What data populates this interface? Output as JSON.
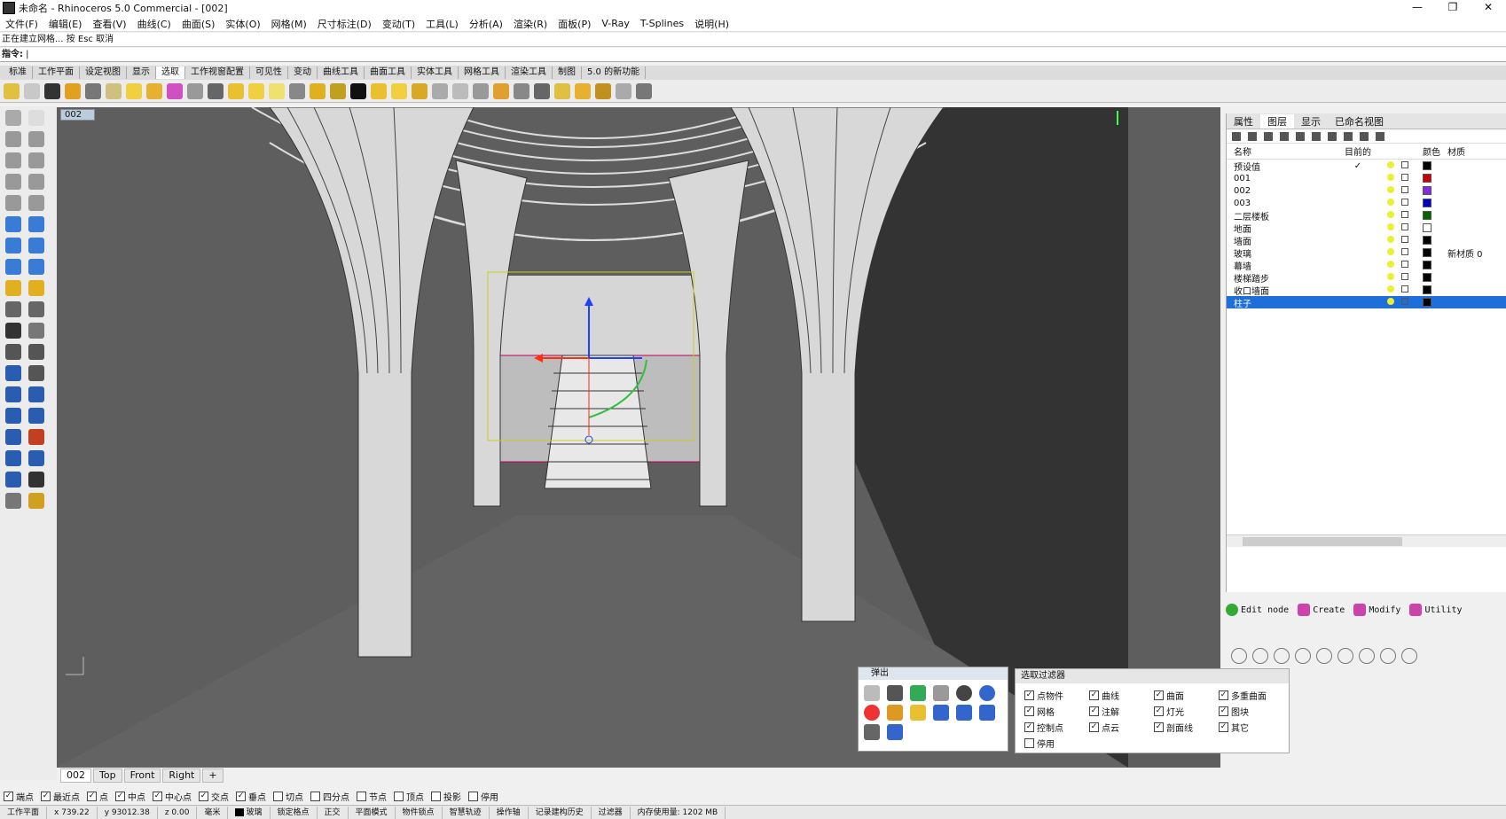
{
  "window": {
    "title": "未命名 - Rhinoceros 5.0 Commercial - [002]",
    "controls": [
      "—",
      "❐",
      "✕"
    ]
  },
  "menu": [
    "文件(F)",
    "编辑(E)",
    "查看(V)",
    "曲线(C)",
    "曲面(S)",
    "实体(O)",
    "网格(M)",
    "尺寸标注(D)",
    "变动(T)",
    "工具(L)",
    "分析(A)",
    "渲染(R)",
    "面板(P)",
    "V-Ray",
    "T-Splines",
    "说明(H)"
  ],
  "command": {
    "history": "正在建立网格... 按 Esc 取消",
    "prompt": "指令:"
  },
  "toolbar_tabs": [
    "标准",
    "工作平面",
    "设定视图",
    "显示",
    "选取",
    "工作视窗配置",
    "可见性",
    "变动",
    "曲线工具",
    "曲面工具",
    "实体工具",
    "网格工具",
    "渲染工具",
    "制图",
    "5.0 的新功能"
  ],
  "toolbar_active_tab": "选取",
  "viewport": {
    "label": "002",
    "tabs": [
      "002",
      "Top",
      "Front",
      "Right",
      "+"
    ]
  },
  "right_panel": {
    "tabs": [
      "属性",
      "图层",
      "显示",
      "已命名视图"
    ],
    "columns": [
      "名称",
      "目前的",
      "颜色",
      "材质"
    ],
    "layers": [
      {
        "name": "预设值",
        "current": "✓",
        "color": "#000000",
        "material": ""
      },
      {
        "name": "001",
        "current": "",
        "color": "#cc0000",
        "material": ""
      },
      {
        "name": "002",
        "current": "",
        "color": "#8a2be2",
        "material": ""
      },
      {
        "name": "003",
        "current": "",
        "color": "#0000cc",
        "material": ""
      },
      {
        "name": "二层楼板",
        "current": "",
        "color": "#006600",
        "material": ""
      },
      {
        "name": "地面",
        "current": "",
        "color": "#ffffff",
        "material": ""
      },
      {
        "name": "墙面",
        "current": "",
        "color": "#000000",
        "material": ""
      },
      {
        "name": "玻璃",
        "current": "",
        "color": "#000000",
        "material": "新材质 0"
      },
      {
        "name": "幕墙",
        "current": "",
        "color": "#000000",
        "material": ""
      },
      {
        "name": "楼梯踏步",
        "current": "",
        "color": "#000000",
        "material": ""
      },
      {
        "name": "收口墙面",
        "current": "",
        "color": "#000000",
        "material": ""
      },
      {
        "name": "柱子",
        "current": "",
        "color": "#000000",
        "material": ""
      }
    ],
    "selected_layer": "柱子"
  },
  "vray": {
    "buttons": [
      "Edit node",
      "Create",
      "Modify",
      "Utility"
    ]
  },
  "popup": {
    "title": "弹出"
  },
  "selection_filter": {
    "title": "选取过滤器",
    "items": [
      {
        "label": "点物件",
        "checked": true
      },
      {
        "label": "曲线",
        "checked": true
      },
      {
        "label": "曲面",
        "checked": true
      },
      {
        "label": "多重曲面",
        "checked": true
      },
      {
        "label": "网格",
        "checked": true
      },
      {
        "label": "注解",
        "checked": true
      },
      {
        "label": "灯光",
        "checked": true
      },
      {
        "label": "图块",
        "checked": true
      },
      {
        "label": "控制点",
        "checked": true
      },
      {
        "label": "点云",
        "checked": true
      },
      {
        "label": "剖面线",
        "checked": true
      },
      {
        "label": "其它",
        "checked": true
      },
      {
        "label": "停用",
        "checked": false
      }
    ]
  },
  "osnap": [
    {
      "label": "端点",
      "checked": true
    },
    {
      "label": "最近点",
      "checked": true
    },
    {
      "label": "点",
      "checked": true
    },
    {
      "label": "中点",
      "checked": true
    },
    {
      "label": "中心点",
      "checked": true
    },
    {
      "label": "交点",
      "checked": true
    },
    {
      "label": "垂点",
      "checked": true
    },
    {
      "label": "切点",
      "checked": false
    },
    {
      "label": "四分点",
      "checked": false
    },
    {
      "label": "节点",
      "checked": false
    },
    {
      "label": "顶点",
      "checked": false
    },
    {
      "label": "投影",
      "checked": false
    },
    {
      "label": "停用",
      "checked": false
    }
  ],
  "status": {
    "cplane": "工作平面",
    "x": "x 739.22",
    "y": "y 93012.38",
    "z": "z 0.00",
    "unit": "毫米",
    "layer": "玻璃",
    "toggles": [
      "锁定格点",
      "正交",
      "平面模式",
      "物件锁点",
      "智慧轨迹",
      "操作轴",
      "记录建构历史",
      "过滤器"
    ],
    "memory": "内存使用量: 1202 MB"
  }
}
